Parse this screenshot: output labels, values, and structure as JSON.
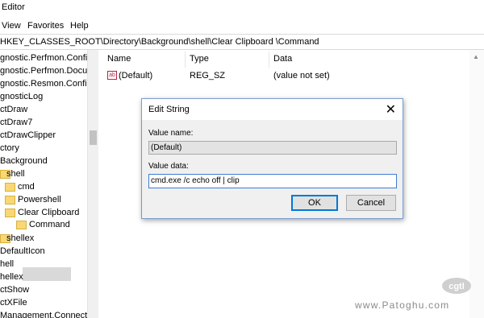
{
  "window": {
    "title": "Editor"
  },
  "menu": [
    "View",
    "Favorites",
    "Help"
  ],
  "address": "HKEY_CLASSES_ROOT\\Directory\\Background\\shell\\Clear Clipboard \\Command",
  "tree": {
    "items": [
      "gnostic.Perfmon.Config",
      "gnostic.Perfmon.Docum",
      "gnostic.Resmon.Config",
      "gnosticLog",
      "ctDraw",
      "ctDraw7",
      "ctDrawClipper",
      "ctory",
      "Background",
      "shell",
      "cmd",
      "Powershell",
      "Clear Clipboard",
      "Command",
      "shellex",
      "DefaultIcon",
      "hell",
      "hellex",
      "ctShow",
      "ctXFile",
      "Management.Connectio"
    ]
  },
  "list": {
    "columns": [
      "Name",
      "Type",
      "Data"
    ],
    "rows": [
      {
        "name": "(Default)",
        "type": "REG_SZ",
        "data": "(value not set)",
        "icon": "reg-string-icon"
      }
    ]
  },
  "dialog": {
    "title": "Edit String",
    "value_name_label": "Value name:",
    "value_name": "(Default)",
    "value_data_label": "Value data:",
    "value_data": "cmd.exe /c echo off | clip",
    "ok_label": "OK",
    "cancel_label": "Cancel"
  },
  "watermark": {
    "logo_text": "Patoghu",
    "site": "www.Patoghu.com"
  },
  "colors": {
    "selection": "#d9d9d9",
    "folder": "#f8d775",
    "dialog_accent": "#0078d7"
  }
}
